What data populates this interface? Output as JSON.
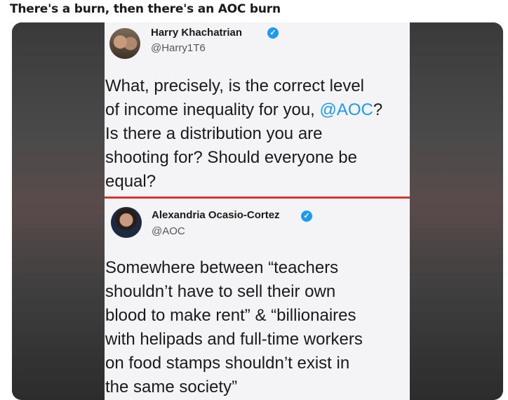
{
  "post": {
    "title": "There's a burn, then there's an AOC burn"
  },
  "tweet1": {
    "name": "Harry Khachatrian",
    "handle": "@Harry1T6",
    "text_before": "What, precisely, is the correct level\nof income inequality for you, ",
    "mention": "@AOC",
    "text_after": "?\nIs there a distribution you are\nshooting for? Should everyone be\nequal?"
  },
  "tweet2": {
    "name": "Alexandria Ocasio-Cortez",
    "handle": "@AOC",
    "text": "Somewhere between “teachers\nshouldn’t have to sell their own\nblood to make rent” & “billionaires\nwith helipads and full-time workers\non food stamps shouldn’t exist in\nthe same society”"
  },
  "colors": {
    "verified": "#1d9bf0",
    "divider": "#e0302b",
    "mention": "#1d9bf0"
  }
}
